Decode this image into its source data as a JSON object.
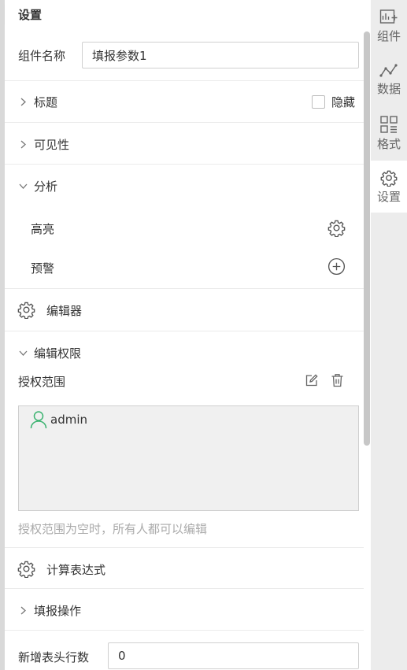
{
  "panel": {
    "title": "设置",
    "component_name_label": "组件名称",
    "component_name_value": "填报参数1",
    "title_section": "标题",
    "hide_label": "隐藏",
    "visibility_section": "可见性",
    "analysis_section": "分析",
    "highlight_label": "高亮",
    "warning_label": "预警",
    "editor_label": "编辑器",
    "edit_permission_section": "编辑权限",
    "auth_scope_label": "授权范围",
    "auth_users": [
      "admin"
    ],
    "auth_hint": "授权范围为空时，所有人都可以编辑",
    "calc_expression_label": "计算表达式",
    "fill_operation_section": "填报操作",
    "new_header_rows_label": "新增表头行数",
    "new_header_rows_value": "0"
  },
  "right_bar": {
    "items": [
      {
        "label": "组件",
        "icon": "component-icon"
      },
      {
        "label": "数据",
        "icon": "data-icon"
      },
      {
        "label": "格式",
        "icon": "format-icon"
      },
      {
        "label": "设置",
        "icon": "gear-icon"
      }
    ]
  },
  "colors": {
    "accent_user": "#3cb371",
    "right_bar_bg": "#ececec",
    "icon_gray": "#666666"
  }
}
